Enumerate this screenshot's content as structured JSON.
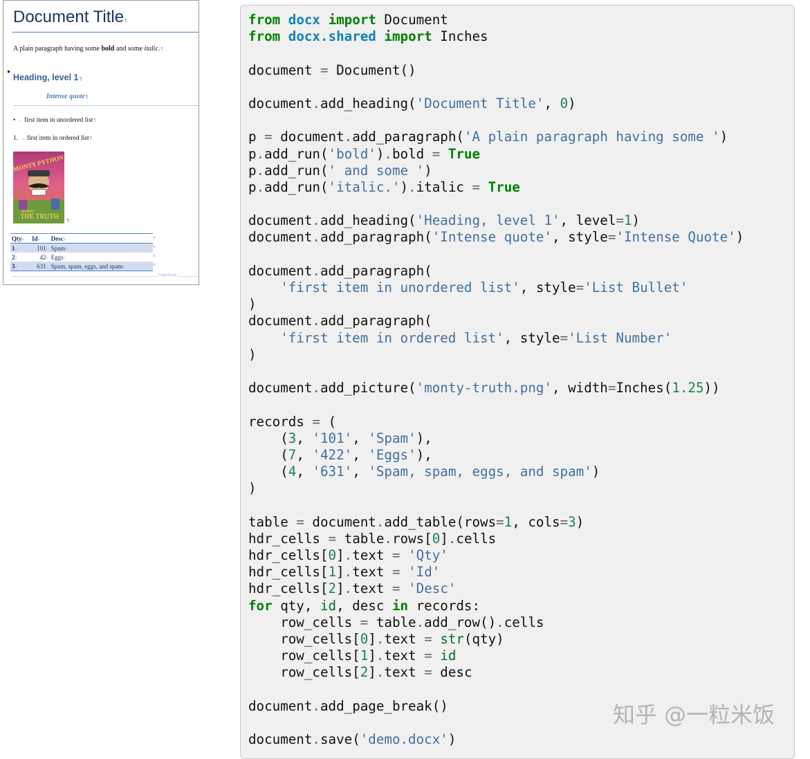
{
  "document_preview": {
    "title": "Document Title",
    "pilcrow": "¶",
    "cell_mark": "¤",
    "paragraph": {
      "plain": "A plain paragraph having some ",
      "bold": "bold",
      "middle": " and some ",
      "italic": "italic."
    },
    "heading1": "Heading, level 1",
    "intense_quote": "Intense quote",
    "bullet_symbol": "•",
    "bullet_item": "first item in unordered list",
    "ordered_number": "1.",
    "ordered_item": "first item in ordered list",
    "tab_arrow": "→",
    "poster": {
      "top_text": "MONTY PYTHON",
      "bottom_text": "THE TRUTH",
      "small_text": "ALMOST"
    },
    "table": {
      "headers": [
        "Qty",
        "Id",
        "Desc"
      ],
      "rows": [
        [
          "1",
          "101",
          "Spam"
        ],
        [
          "2",
          "42",
          "Eggs"
        ],
        [
          "3",
          "631",
          "Spam, spam, eggs, and spam"
        ]
      ]
    },
    "page_break_label": "Page Break"
  },
  "code": {
    "lines": [
      [
        [
          "kw",
          "from"
        ],
        [
          "t",
          " "
        ],
        [
          "mod",
          "docx"
        ],
        [
          "t",
          " "
        ],
        [
          "kw",
          "import"
        ],
        [
          "t",
          " Document"
        ]
      ],
      [
        [
          "kw",
          "from"
        ],
        [
          "t",
          " "
        ],
        [
          "mod",
          "docx.shared"
        ],
        [
          "t",
          " "
        ],
        [
          "kw",
          "import"
        ],
        [
          "t",
          " Inches"
        ]
      ],
      [],
      [
        [
          "t",
          "document "
        ],
        [
          "op",
          "="
        ],
        [
          "t",
          " Document()"
        ]
      ],
      [],
      [
        [
          "t",
          "document"
        ],
        [
          "op",
          "."
        ],
        [
          "t",
          "add_heading("
        ],
        [
          "str",
          "'Document Title'"
        ],
        [
          "t",
          ", "
        ],
        [
          "num",
          "0"
        ],
        [
          "t",
          ")"
        ]
      ],
      [],
      [
        [
          "t",
          "p "
        ],
        [
          "op",
          "="
        ],
        [
          "t",
          " document"
        ],
        [
          "op",
          "."
        ],
        [
          "t",
          "add_paragraph("
        ],
        [
          "str",
          "'A plain paragraph having some '"
        ],
        [
          "t",
          ")"
        ]
      ],
      [
        [
          "t",
          "p"
        ],
        [
          "op",
          "."
        ],
        [
          "t",
          "add_run("
        ],
        [
          "str",
          "'bold'"
        ],
        [
          "t",
          ")"
        ],
        [
          "op",
          "."
        ],
        [
          "t",
          "bold "
        ],
        [
          "op",
          "="
        ],
        [
          "t",
          " "
        ],
        [
          "kw",
          "True"
        ]
      ],
      [
        [
          "t",
          "p"
        ],
        [
          "op",
          "."
        ],
        [
          "t",
          "add_run("
        ],
        [
          "str",
          "' and some '"
        ],
        [
          "t",
          ")"
        ]
      ],
      [
        [
          "t",
          "p"
        ],
        [
          "op",
          "."
        ],
        [
          "t",
          "add_run("
        ],
        [
          "str",
          "'italic.'"
        ],
        [
          "t",
          ")"
        ],
        [
          "op",
          "."
        ],
        [
          "t",
          "italic "
        ],
        [
          "op",
          "="
        ],
        [
          "t",
          " "
        ],
        [
          "kw",
          "True"
        ]
      ],
      [],
      [
        [
          "t",
          "document"
        ],
        [
          "op",
          "."
        ],
        [
          "t",
          "add_heading("
        ],
        [
          "str",
          "'Heading, level 1'"
        ],
        [
          "t",
          ", level"
        ],
        [
          "op",
          "="
        ],
        [
          "num",
          "1"
        ],
        [
          "t",
          ")"
        ]
      ],
      [
        [
          "t",
          "document"
        ],
        [
          "op",
          "."
        ],
        [
          "t",
          "add_paragraph("
        ],
        [
          "str",
          "'Intense quote'"
        ],
        [
          "t",
          ", style"
        ],
        [
          "op",
          "="
        ],
        [
          "str",
          "'Intense Quote'"
        ],
        [
          "t",
          ")"
        ]
      ],
      [],
      [
        [
          "t",
          "document"
        ],
        [
          "op",
          "."
        ],
        [
          "t",
          "add_paragraph("
        ]
      ],
      [
        [
          "t",
          "    "
        ],
        [
          "str",
          "'first item in unordered list'"
        ],
        [
          "t",
          ", style"
        ],
        [
          "op",
          "="
        ],
        [
          "str",
          "'List Bullet'"
        ]
      ],
      [
        [
          "t",
          ")"
        ]
      ],
      [
        [
          "t",
          "document"
        ],
        [
          "op",
          "."
        ],
        [
          "t",
          "add_paragraph("
        ]
      ],
      [
        [
          "t",
          "    "
        ],
        [
          "str",
          "'first item in ordered list'"
        ],
        [
          "t",
          ", style"
        ],
        [
          "op",
          "="
        ],
        [
          "str",
          "'List Number'"
        ]
      ],
      [
        [
          "t",
          ")"
        ]
      ],
      [],
      [
        [
          "t",
          "document"
        ],
        [
          "op",
          "."
        ],
        [
          "t",
          "add_picture("
        ],
        [
          "str",
          "'monty-truth.png'"
        ],
        [
          "t",
          ", width"
        ],
        [
          "op",
          "="
        ],
        [
          "t",
          "Inches("
        ],
        [
          "num",
          "1.25"
        ],
        [
          "t",
          "))"
        ]
      ],
      [],
      [
        [
          "t",
          "records "
        ],
        [
          "op",
          "="
        ],
        [
          "t",
          " ("
        ]
      ],
      [
        [
          "t",
          "    ("
        ],
        [
          "num",
          "3"
        ],
        [
          "t",
          ", "
        ],
        [
          "str",
          "'101'"
        ],
        [
          "t",
          ", "
        ],
        [
          "str",
          "'Spam'"
        ],
        [
          "t",
          "),"
        ]
      ],
      [
        [
          "t",
          "    ("
        ],
        [
          "num",
          "7"
        ],
        [
          "t",
          ", "
        ],
        [
          "str",
          "'422'"
        ],
        [
          "t",
          ", "
        ],
        [
          "str",
          "'Eggs'"
        ],
        [
          "t",
          "),"
        ]
      ],
      [
        [
          "t",
          "    ("
        ],
        [
          "num",
          "4"
        ],
        [
          "t",
          ", "
        ],
        [
          "str",
          "'631'"
        ],
        [
          "t",
          ", "
        ],
        [
          "str",
          "'Spam, spam, eggs, and spam'"
        ],
        [
          "t",
          ")"
        ]
      ],
      [
        [
          "t",
          ")"
        ]
      ],
      [],
      [
        [
          "t",
          "table "
        ],
        [
          "op",
          "="
        ],
        [
          "t",
          " document"
        ],
        [
          "op",
          "."
        ],
        [
          "t",
          "add_table(rows"
        ],
        [
          "op",
          "="
        ],
        [
          "num",
          "1"
        ],
        [
          "t",
          ", cols"
        ],
        [
          "op",
          "="
        ],
        [
          "num",
          "3"
        ],
        [
          "t",
          ")"
        ]
      ],
      [
        [
          "t",
          "hdr_cells "
        ],
        [
          "op",
          "="
        ],
        [
          "t",
          " table"
        ],
        [
          "op",
          "."
        ],
        [
          "t",
          "rows["
        ],
        [
          "num",
          "0"
        ],
        [
          "t",
          "]"
        ],
        [
          "op",
          "."
        ],
        [
          "t",
          "cells"
        ]
      ],
      [
        [
          "t",
          "hdr_cells["
        ],
        [
          "num",
          "0"
        ],
        [
          "t",
          "]"
        ],
        [
          "op",
          "."
        ],
        [
          "t",
          "text "
        ],
        [
          "op",
          "="
        ],
        [
          "t",
          " "
        ],
        [
          "str",
          "'Qty'"
        ]
      ],
      [
        [
          "t",
          "hdr_cells["
        ],
        [
          "num",
          "1"
        ],
        [
          "t",
          "]"
        ],
        [
          "op",
          "."
        ],
        [
          "t",
          "text "
        ],
        [
          "op",
          "="
        ],
        [
          "t",
          " "
        ],
        [
          "str",
          "'Id'"
        ]
      ],
      [
        [
          "t",
          "hdr_cells["
        ],
        [
          "num",
          "2"
        ],
        [
          "t",
          "]"
        ],
        [
          "op",
          "."
        ],
        [
          "t",
          "text "
        ],
        [
          "op",
          "="
        ],
        [
          "t",
          " "
        ],
        [
          "str",
          "'Desc'"
        ]
      ],
      [
        [
          "kw",
          "for"
        ],
        [
          "t",
          " qty, "
        ],
        [
          "bi",
          "id"
        ],
        [
          "t",
          ", desc "
        ],
        [
          "kw",
          "in"
        ],
        [
          "t",
          " records:"
        ]
      ],
      [
        [
          "t",
          "    row_cells "
        ],
        [
          "op",
          "="
        ],
        [
          "t",
          " table"
        ],
        [
          "op",
          "."
        ],
        [
          "t",
          "add_row()"
        ],
        [
          "op",
          "."
        ],
        [
          "t",
          "cells"
        ]
      ],
      [
        [
          "t",
          "    row_cells["
        ],
        [
          "num",
          "0"
        ],
        [
          "t",
          "]"
        ],
        [
          "op",
          "."
        ],
        [
          "t",
          "text "
        ],
        [
          "op",
          "="
        ],
        [
          "t",
          " "
        ],
        [
          "bi",
          "str"
        ],
        [
          "t",
          "(qty)"
        ]
      ],
      [
        [
          "t",
          "    row_cells["
        ],
        [
          "num",
          "1"
        ],
        [
          "t",
          "]"
        ],
        [
          "op",
          "."
        ],
        [
          "t",
          "text "
        ],
        [
          "op",
          "="
        ],
        [
          "t",
          " "
        ],
        [
          "bi",
          "id"
        ]
      ],
      [
        [
          "t",
          "    row_cells["
        ],
        [
          "num",
          "2"
        ],
        [
          "t",
          "]"
        ],
        [
          "op",
          "."
        ],
        [
          "t",
          "text "
        ],
        [
          "op",
          "="
        ],
        [
          "t",
          " desc"
        ]
      ],
      [],
      [
        [
          "t",
          "document"
        ],
        [
          "op",
          "."
        ],
        [
          "t",
          "add_page_break()"
        ]
      ],
      [],
      [
        [
          "t",
          "document"
        ],
        [
          "op",
          "."
        ],
        [
          "t",
          "save("
        ],
        [
          "str",
          "'demo.docx'"
        ],
        [
          "t",
          ")"
        ]
      ]
    ]
  },
  "watermark": "知乎 @一粒米饭"
}
